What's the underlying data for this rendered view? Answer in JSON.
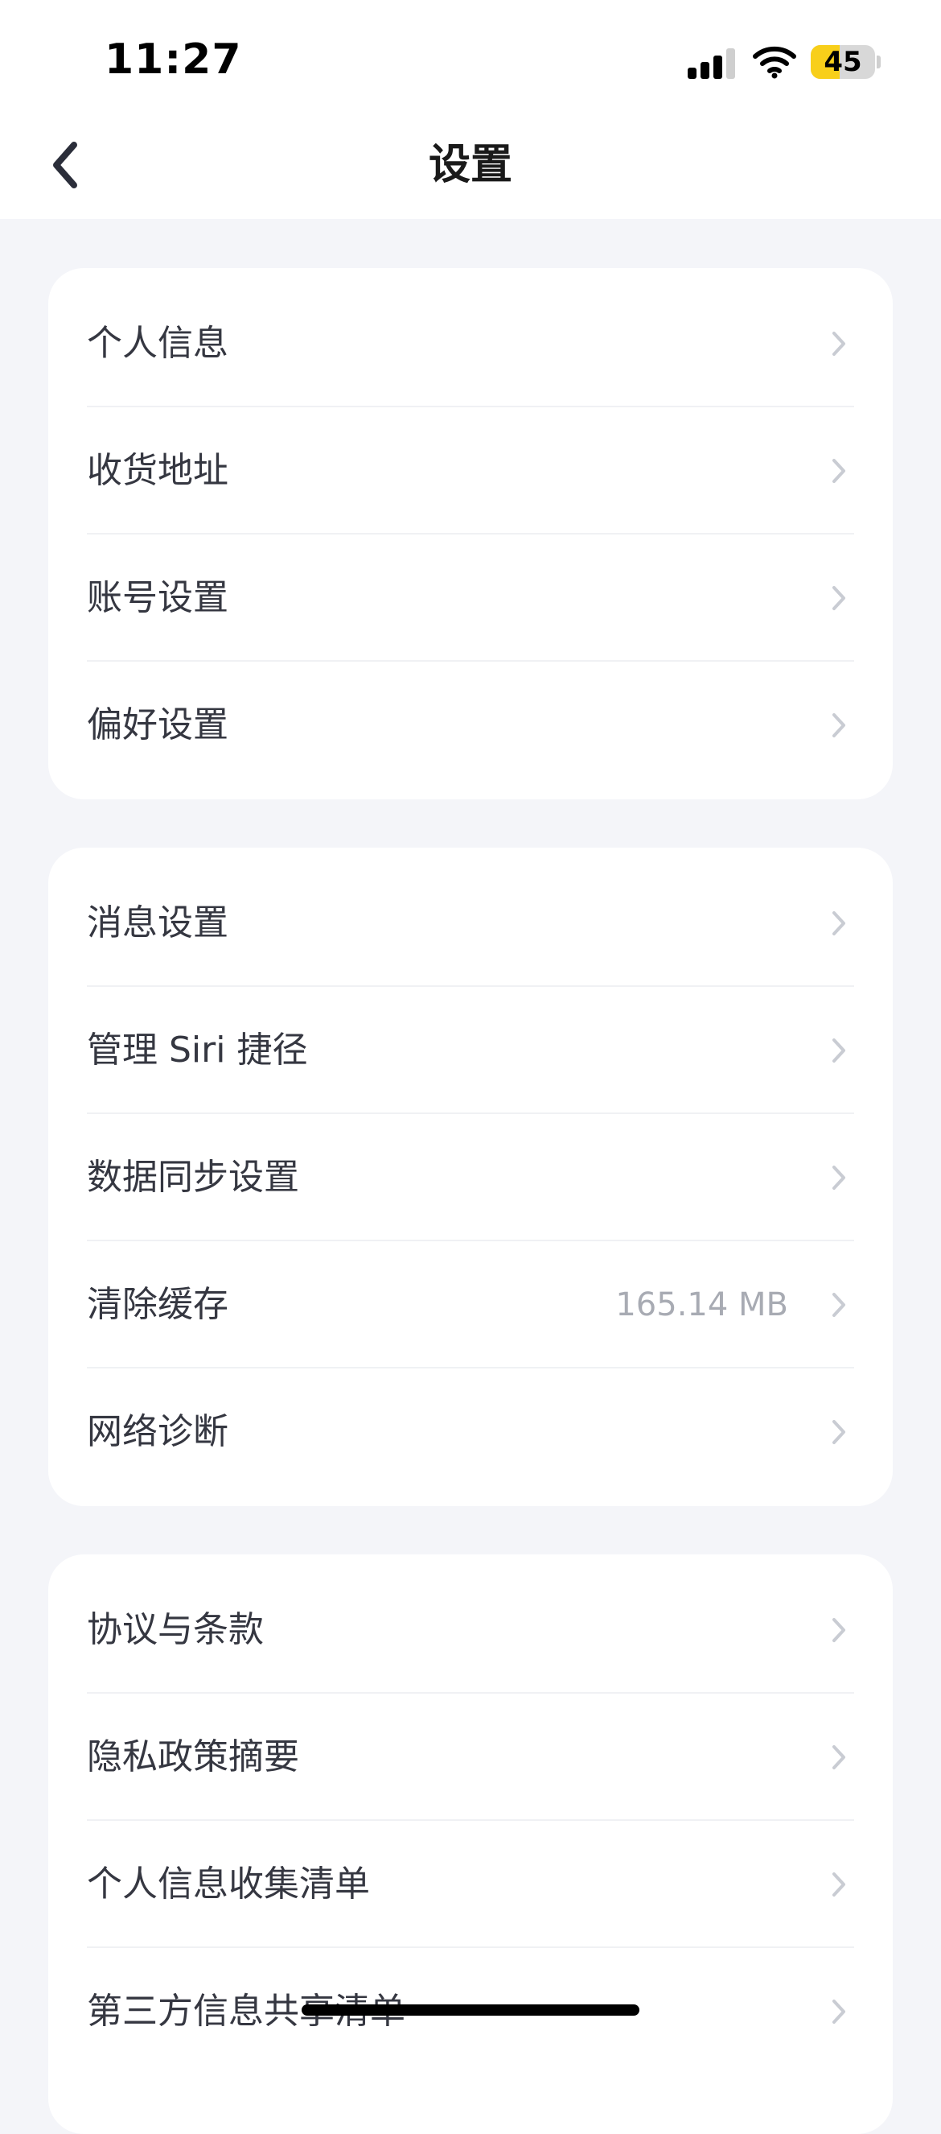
{
  "status_bar": {
    "time": "11:27",
    "battery_level": "45",
    "battery_fraction": 0.45,
    "battery_color": "#f8cf1a"
  },
  "header": {
    "title": "设置",
    "back_icon": "chevron-left-icon"
  },
  "sections": [
    {
      "items": [
        {
          "label": "个人信息",
          "value": ""
        },
        {
          "label": "收货地址",
          "value": ""
        },
        {
          "label": "账号设置",
          "value": ""
        },
        {
          "label": "偏好设置",
          "value": ""
        }
      ]
    },
    {
      "items": [
        {
          "label": "消息设置",
          "value": ""
        },
        {
          "label": "管理 Siri 捷径",
          "value": ""
        },
        {
          "label": "数据同步设置",
          "value": ""
        },
        {
          "label": "清除缓存",
          "value": "165.14 MB"
        },
        {
          "label": "网络诊断",
          "value": ""
        }
      ]
    },
    {
      "items": [
        {
          "label": "协议与条款",
          "value": ""
        },
        {
          "label": "隐私政策摘要",
          "value": ""
        },
        {
          "label": "个人信息收集清单",
          "value": ""
        },
        {
          "label": "第三方信息共享清单",
          "value": ""
        }
      ]
    }
  ]
}
